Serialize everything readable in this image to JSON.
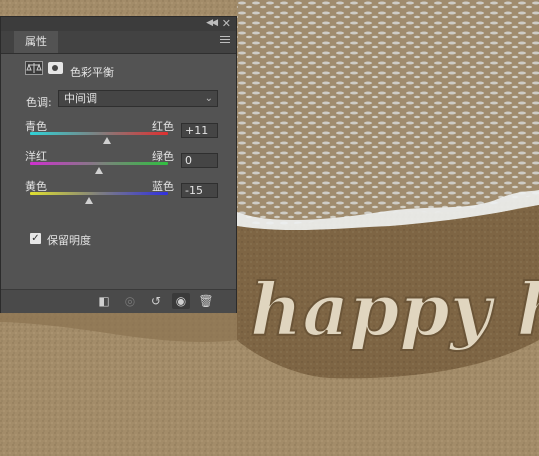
{
  "background": {
    "sand_text": "happy hol"
  },
  "panel": {
    "tab_label": "属性",
    "adjustment_title": "色彩平衡",
    "tone": {
      "label": "色调:",
      "selected": "中间调"
    },
    "sliders": [
      {
        "left_label": "青色",
        "right_label": "红色",
        "value": "+11",
        "position": 0.555
      },
      {
        "left_label": "洋红",
        "right_label": "绿色",
        "value": "0",
        "position": 0.5
      },
      {
        "left_label": "黄色",
        "right_label": "蓝色",
        "value": "-15",
        "position": 0.425
      }
    ],
    "preserve_luminosity": {
      "label": "保留明度",
      "checked": true
    },
    "icons": {
      "collapse": "double-chevron-icon",
      "close": "close-icon",
      "menu": "panel-menu-icon",
      "balance": "color-balance-icon",
      "mask": "layer-mask-icon",
      "clip": "clip-to-layer-icon",
      "view_previous": "view-previous-state-icon",
      "reset": "reset-icon",
      "visibility": "eye-icon",
      "delete": "trash-icon"
    }
  }
}
